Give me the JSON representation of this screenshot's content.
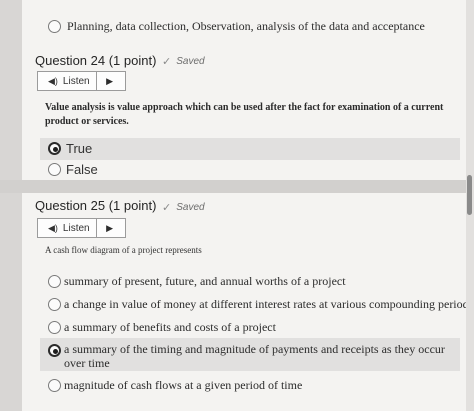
{
  "q23": {
    "last_option": "Planning, data collection, Observation, analysis of the data and acceptance"
  },
  "q24": {
    "title": "Question 24 (1 point)",
    "saved": "Saved",
    "listen": "Listen",
    "question": "Value analysis is value approach which can be used after the fact for examination of a current product or services.",
    "options": [
      {
        "label": "True",
        "selected": true
      },
      {
        "label": "False",
        "selected": false
      }
    ]
  },
  "q25": {
    "title": "Question 25 (1 point)",
    "saved": "Saved",
    "listen": "Listen",
    "question": "A cash flow diagram of a project represents",
    "options": [
      {
        "label": "summary of present, future, and annual worths of a project",
        "selected": false
      },
      {
        "label": "a change in value of money at different interest rates at various compounding periods",
        "selected": false
      },
      {
        "label": "a summary of benefits and costs of a project",
        "selected": false
      },
      {
        "label": "a summary of the timing and magnitude of payments and receipts as they occur over time",
        "selected": true
      },
      {
        "label": "magnitude of cash flows at a given period of time",
        "selected": false
      }
    ]
  },
  "icons": {
    "check": "checkmark-icon",
    "speaker": "speaker-icon",
    "play": "play-icon"
  }
}
